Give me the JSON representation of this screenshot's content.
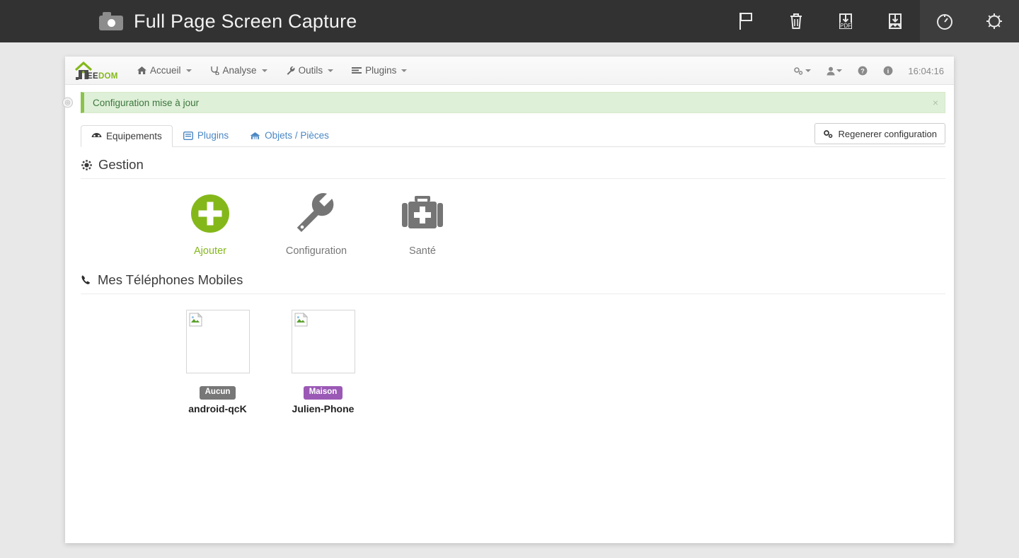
{
  "extension": {
    "title": "Full Page Screen Capture",
    "camera_icon": "camera-icon",
    "actions": [
      {
        "name": "flag-icon",
        "label": "Report"
      },
      {
        "name": "trash-icon",
        "label": "Delete"
      },
      {
        "name": "download-pdf-icon",
        "label": "PDF"
      },
      {
        "name": "download-image-icon",
        "label": "Image"
      },
      {
        "name": "history-timer-icon",
        "label": "History"
      },
      {
        "name": "gear-icon",
        "label": "Options"
      }
    ]
  },
  "app": {
    "logo": {
      "prefix": "",
      "text_dark": "EE",
      "text_green": "DOM"
    },
    "nav": [
      {
        "icon": "home-icon",
        "label": "Accueil",
        "caret": true
      },
      {
        "icon": "pulse-icon",
        "label": "Analyse",
        "caret": true
      },
      {
        "icon": "wrench-icon",
        "label": "Outils",
        "caret": true
      },
      {
        "icon": "list-icon",
        "label": "Plugins",
        "caret": true
      }
    ],
    "nav_right": [
      {
        "icon": "cogs-icon",
        "caret": true
      },
      {
        "icon": "user-icon",
        "caret": true
      },
      {
        "icon": "question-circle-icon",
        "caret": false
      },
      {
        "icon": "info-circle-icon",
        "caret": false
      }
    ],
    "clock": "16:04:16"
  },
  "alert": {
    "message": "Configuration mise à jour",
    "close_label": "×",
    "toggle_icon": "collapse-toggle-icon"
  },
  "tabs": [
    {
      "icon": "dashboard-icon",
      "label": "Equipements",
      "active": true
    },
    {
      "icon": "plugin-icon",
      "label": "Plugins",
      "active": false
    },
    {
      "icon": "house-icon",
      "label": "Objets / Pièces",
      "active": false
    }
  ],
  "regen_button": {
    "icon": "cogs-icon",
    "label": "Regenerer configuration"
  },
  "sections": {
    "gestion": {
      "icon": "gear-icon",
      "title": "Gestion",
      "tiles": [
        {
          "icon": "plus-circle-icon",
          "label": "Ajouter",
          "accent": "#84b81a"
        },
        {
          "icon": "wrench-icon",
          "label": "Configuration",
          "accent": "#757575"
        },
        {
          "icon": "medkit-icon",
          "label": "Santé",
          "accent": "#757575"
        }
      ]
    },
    "phones": {
      "icon": "phone-icon",
      "title": "Mes Téléphones Mobiles",
      "cards": [
        {
          "image": "broken-image-icon",
          "badge": "Aucun",
          "badge_color": "#777777",
          "name": "android-qcK"
        },
        {
          "image": "broken-image-icon",
          "badge": "Maison",
          "badge_color": "#9b59b6",
          "name": "Julien-Phone"
        }
      ]
    }
  },
  "colors": {
    "topbar_bg": "#323232",
    "brand_green": "#84b81a",
    "link_blue": "#4a87c4",
    "alert_bg": "#dff0d8",
    "alert_text": "#3c763d",
    "badge_purple": "#9b59b6",
    "badge_gray": "#777777"
  }
}
